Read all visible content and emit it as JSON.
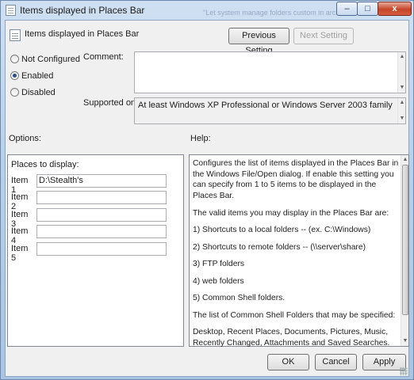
{
  "window": {
    "title": "Items displayed in Places Bar",
    "background_text": "\"Let system manage folders custom in archive\"",
    "controls": {
      "minimize": "–",
      "maximize": "□",
      "close": "x"
    }
  },
  "header": {
    "title": "Items displayed in Places Bar",
    "prev_button": "Previous Setting",
    "next_button": "Next Setting"
  },
  "state_options": [
    {
      "label": "Not Configured",
      "checked": false
    },
    {
      "label": "Enabled",
      "checked": true
    },
    {
      "label": "Disabled",
      "checked": false
    }
  ],
  "comment": {
    "label": "Comment:",
    "value": ""
  },
  "supported_on": {
    "label": "Supported on:",
    "value": "At least Windows XP Professional or Windows Server 2003 family"
  },
  "options": {
    "label": "Options:",
    "places_label": "Places to display:",
    "items": [
      {
        "label": "Item 1",
        "value": "D:\\Stealth's"
      },
      {
        "label": "Item 2",
        "value": ""
      },
      {
        "label": "Item 3",
        "value": ""
      },
      {
        "label": "Item 4",
        "value": ""
      },
      {
        "label": "Item 5",
        "value": ""
      }
    ]
  },
  "help": {
    "label": "Help:",
    "paragraphs": [
      "Configures the list of items displayed in the Places Bar in the Windows File/Open dialog. If enable this setting you can specify from 1 to 5 items to be displayed in the Places Bar.",
      "The valid items you may display in the Places Bar are:",
      "1) Shortcuts to a local folders -- (ex. C:\\Windows)",
      "2) Shortcuts to remote folders -- (\\\\server\\share)",
      "3) FTP folders",
      "4) web folders",
      "5) Common Shell folders.",
      "The list of Common Shell Folders that may be specified:",
      "Desktop, Recent Places, Documents, Pictures, Music, Recently Changed, Attachments and Saved Searches."
    ]
  },
  "footer": {
    "ok": "OK",
    "cancel": "Cancel",
    "apply": "Apply"
  },
  "icons": {
    "window": "policy-document-icon",
    "header": "policy-document-icon",
    "radio_checked_color": "#2a4f86"
  }
}
